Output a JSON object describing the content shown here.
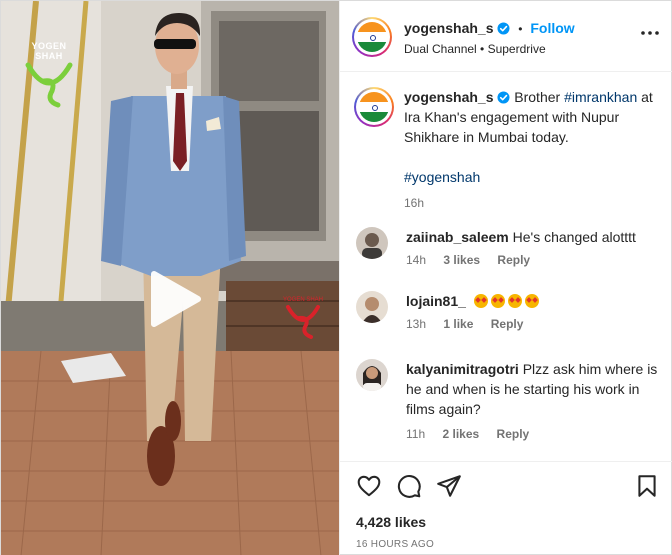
{
  "post": {
    "username": "yogenshah_s",
    "separator": "•",
    "follow_label": "Follow",
    "audio": "Dual Channel • Superdrive",
    "more_icon": "more-horizontal-icon",
    "watermark_top": "YOGEN SHAH",
    "watermark_mid": "YOGEN SHAH"
  },
  "caption": {
    "username": "yogenshah_s",
    "text_before": "Brother ",
    "hashtag1": "#imrankhan",
    "text_after": " at Ira Khan's engagement with Nupur Shikhare in Mumbai today.",
    "hashtag2": "#yogenshah",
    "time": "16h"
  },
  "comments": [
    {
      "user": "zaiinab_saleem",
      "text": "He's changed alotttt",
      "time": "14h",
      "likes": "3 likes",
      "reply": "Reply"
    },
    {
      "user": "lojain81_",
      "text": "",
      "emoji_count": 4,
      "time": "13h",
      "likes": "1 like",
      "reply": "Reply"
    },
    {
      "user": "kalyanimitragotri",
      "text": "Plzz ask him where is he and when is he starting his work in films again?",
      "time": "11h",
      "likes": "2 likes",
      "reply": "Reply"
    }
  ],
  "footer": {
    "likes": "4,428 likes",
    "posted": "16 HOURS AGO"
  },
  "icons": [
    "heart-icon",
    "comment-icon",
    "share-icon",
    "bookmark-icon",
    "play-icon",
    "verified-badge-icon"
  ],
  "colors": {
    "accent": "#0095f6",
    "hashtag": "#00376b",
    "muted": "#737373",
    "verified": "#0095f6"
  }
}
